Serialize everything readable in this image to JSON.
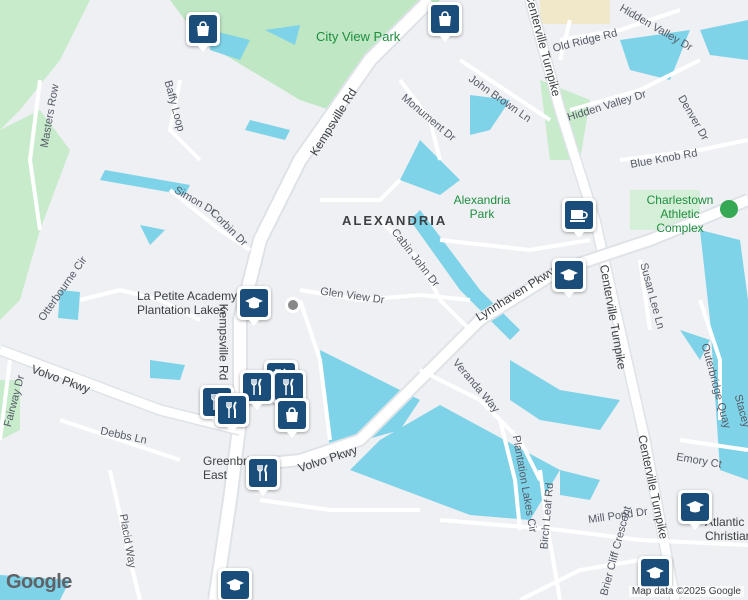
{
  "map": {
    "area_label": "ALEXANDRIA",
    "parks": [
      "City View Park",
      "Alexandria Park"
    ],
    "pois": [
      "Charlestown Athletic Complex",
      "La Petite Academy of Plantation Lakes",
      "Greenbrier East",
      "Atlantic Christian"
    ],
    "roads": {
      "kempsville": "Kempsville Rd",
      "centerville_top": "Centerville Turnpike",
      "centerville_mid": "Centerville Turnpike",
      "centerville_low": "Centerville Turnpike",
      "lynnhaven": "Lynnhaven Pkwy",
      "volvo_w": "Volvo Pkwy",
      "volvo_e": "Volvo Pkwy",
      "glen_view": "Glen View Dr",
      "cabin_john": "Cabin John Dr",
      "monument": "Monument Dr",
      "john_brown": "John Brown Ln",
      "old_ridge": "Old Ridge Rd",
      "hidden_valley_1": "Hidden Valley Dr",
      "hidden_valley_2": "Hidden Valley Dr",
      "denver": "Denver Dr",
      "blue_knob": "Blue Knob Rd",
      "baffy": "Baffy Loop",
      "masters": "Masters Row",
      "simon": "Simon Dr",
      "corbin": "Corbin Dr",
      "otterbourne": "Otterbourne Cir",
      "fairway": "Fairway Dr",
      "debbs": "Debbs Ln",
      "placid": "Placid Way",
      "veranda": "Veranda Way",
      "plantation_lakes": "Plantation Lakes Cir",
      "birch_leaf": "Birch Leaf Rd",
      "mill_pond": "Mill Pond Dr",
      "brier_cliff": "Brier Cliff Crescent",
      "susan_lee": "Susan Lee Ln",
      "outerbridge": "Outerbridge Quay",
      "emory": "Emory Ct",
      "stacey": "Stacey"
    },
    "markers": [
      {
        "icon": "shopping-bag-icon"
      },
      {
        "icon": "shopping-bag-icon"
      },
      {
        "icon": "coffee-cup-icon"
      },
      {
        "icon": "graduation-cap-icon"
      },
      {
        "icon": "graduation-cap-icon"
      },
      {
        "icon": "restaurant-icon"
      },
      {
        "icon": "restaurant-icon"
      },
      {
        "icon": "restaurant-icon"
      },
      {
        "icon": "restaurant-icon"
      },
      {
        "icon": "shopping-bag-icon"
      },
      {
        "icon": "restaurant-icon"
      },
      {
        "icon": "graduation-cap-icon"
      },
      {
        "icon": "graduation-cap-icon"
      },
      {
        "icon": "graduation-cap-icon"
      }
    ],
    "logo": "Google",
    "attribution": "Map data ©2025 Google",
    "colors": {
      "water": "#7fd3e8",
      "park": "#bfe7c4",
      "marker": "#1a4d7a",
      "road": "#ffffff",
      "land": "#eef0f3"
    }
  }
}
